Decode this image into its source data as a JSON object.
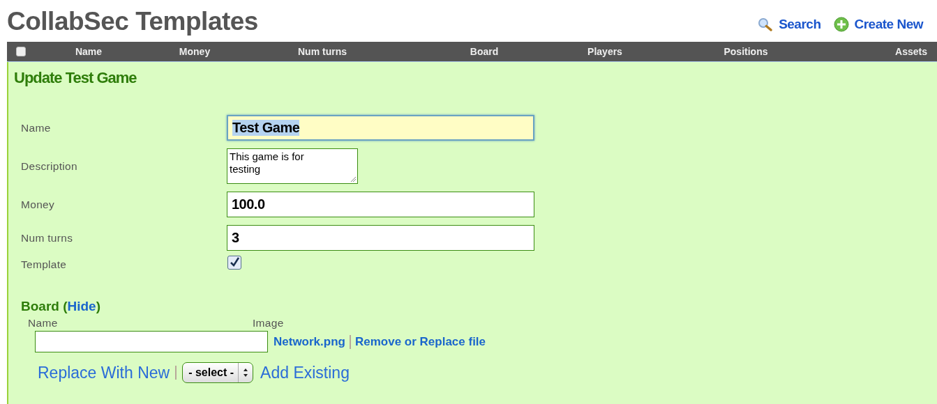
{
  "title": "CollabSec Templates",
  "top_links": [
    {
      "label": "Search",
      "kind": "search"
    },
    {
      "label": "Create New",
      "kind": "create"
    }
  ],
  "table_header": {
    "select_all_checked": false,
    "columns": [
      "Name",
      "Money",
      "Num turns",
      "Board",
      "Players",
      "Positions",
      "Assets"
    ]
  },
  "panel": {
    "heading": "Update Test Game",
    "fields": [
      {
        "kind": "text",
        "label": "Name",
        "value": "Test Game",
        "focused": true,
        "selected": true
      },
      {
        "kind": "textarea",
        "label": "Description",
        "value": "This game is for testing"
      },
      {
        "kind": "text",
        "label": "Money",
        "value": "100.0",
        "focused": false,
        "selected": false
      },
      {
        "kind": "text",
        "label": "Num turns",
        "value": "3",
        "focused": false,
        "selected": false
      },
      {
        "kind": "checkbox",
        "label": "Template",
        "checked": true
      }
    ],
    "board": {
      "heading": "Board",
      "open_paren": "(",
      "toggle": "Hide",
      "close_paren": ")",
      "name_label": "Name",
      "image_label": "Image",
      "file_name": "Network.png",
      "file_action": "Remove or Replace file",
      "replace_link": "Replace With New",
      "select_value": "- select -",
      "add_link": "Add Existing"
    }
  }
}
